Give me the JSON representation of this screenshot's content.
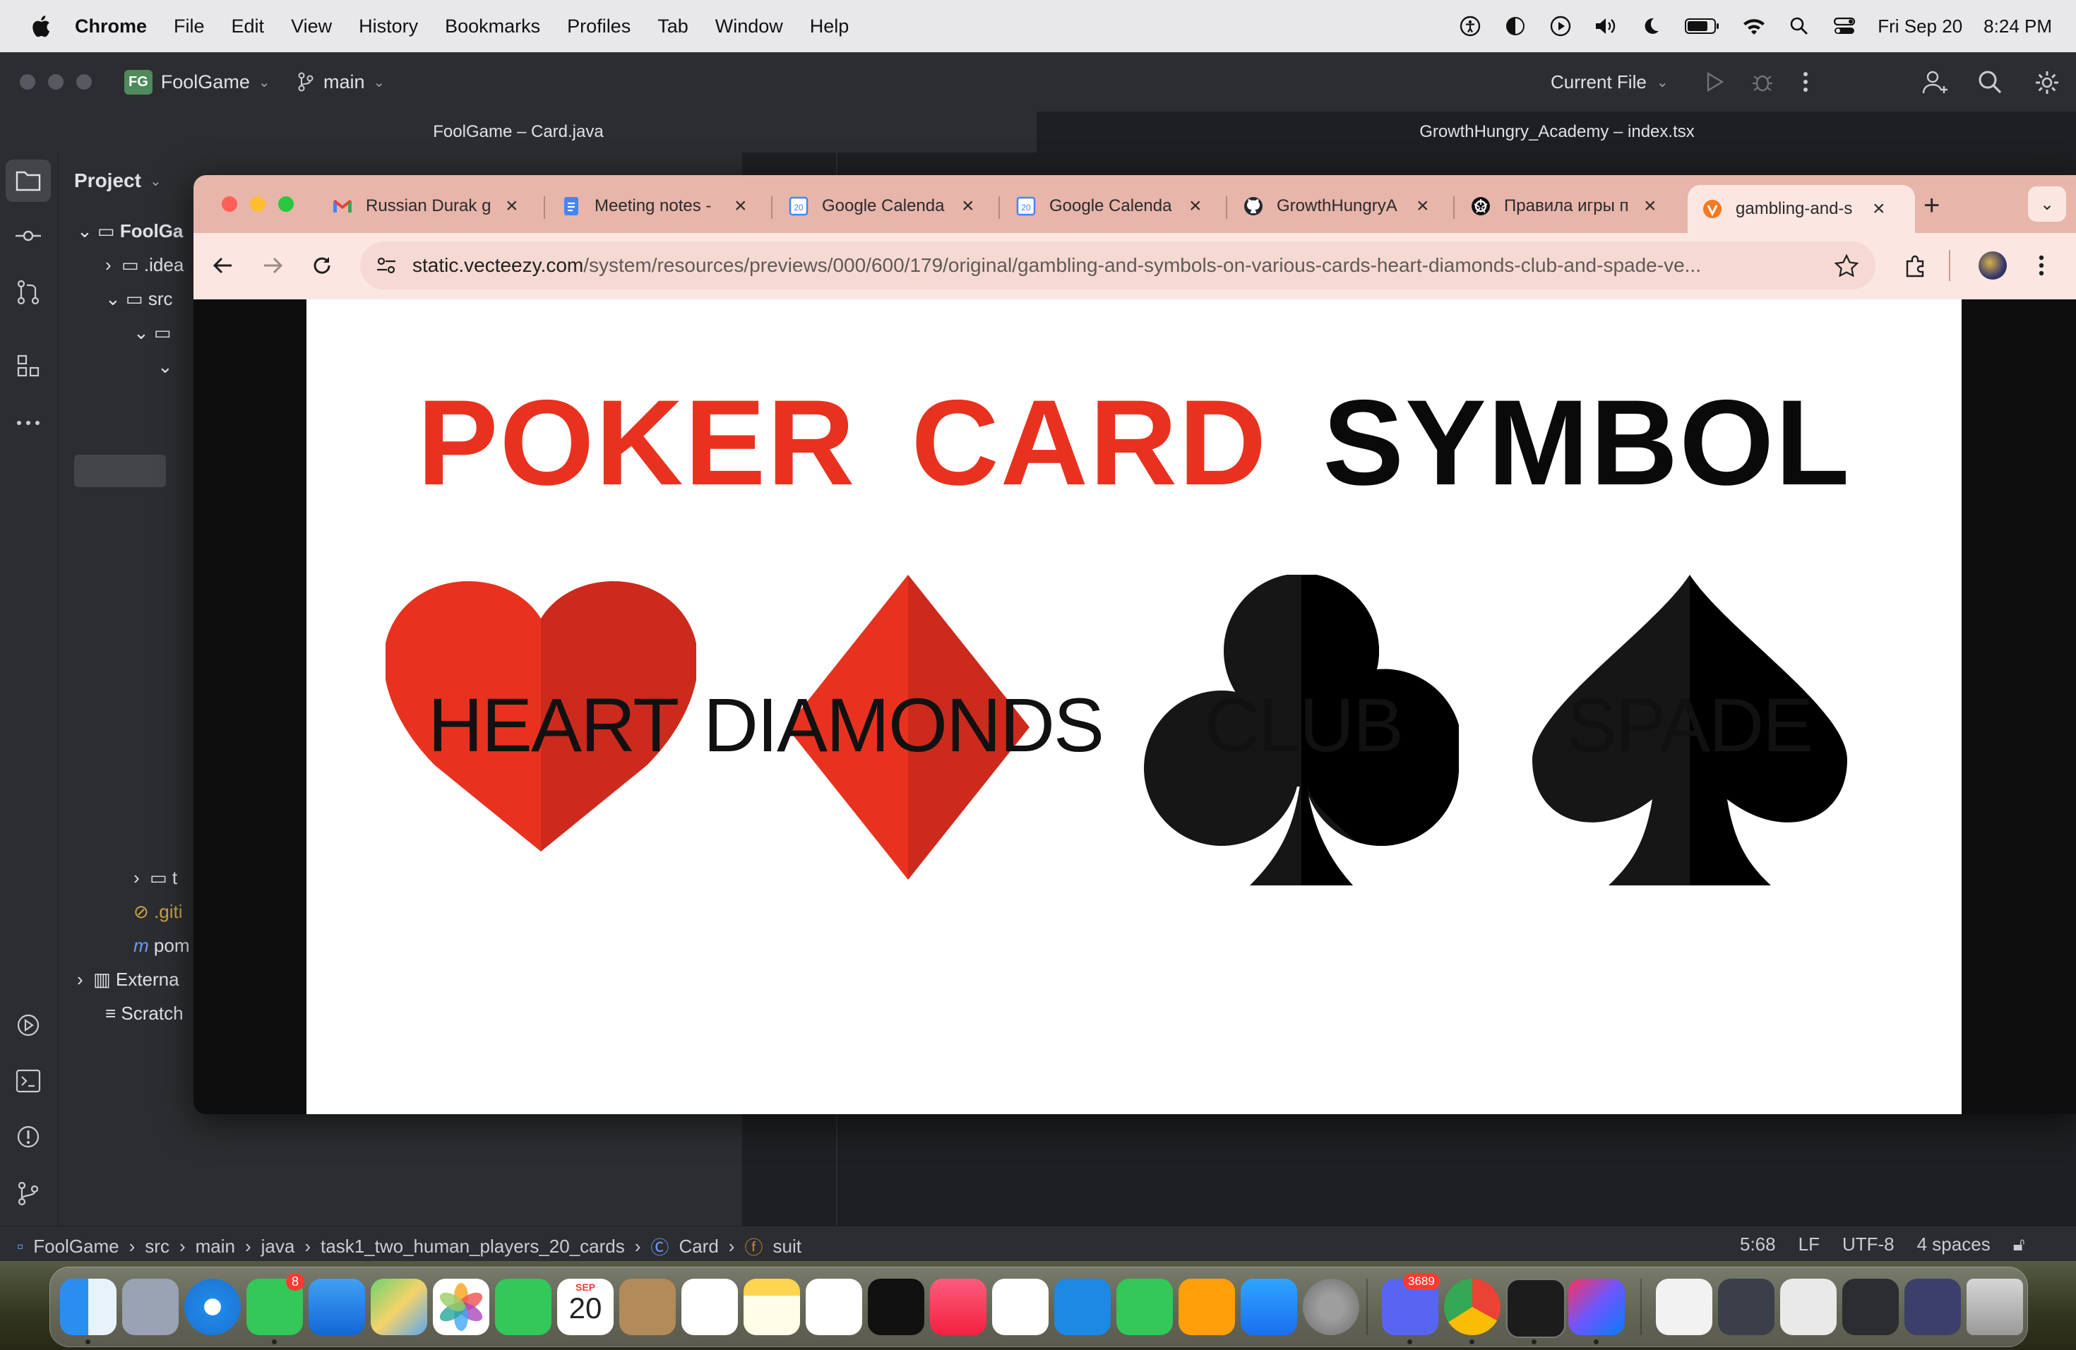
{
  "menubar": {
    "app_name": "Chrome",
    "items": [
      "File",
      "Edit",
      "View",
      "History",
      "Bookmarks",
      "Profiles",
      "Tab",
      "Window",
      "Help"
    ],
    "date": "Fri Sep 20",
    "time": "8:24 PM"
  },
  "ide": {
    "project_badge": "FG",
    "project_name": "FoolGame",
    "branch": "main",
    "run_config": "Current File",
    "window_tabs": [
      "FoolGame – Card.java",
      "GrowthHungry_Academy – index.tsx"
    ],
    "panel_title": "Project",
    "tree": [
      ".idea",
      "src",
      "t",
      ".giti",
      "pom",
      "Externa",
      "Scratch"
    ],
    "tree_root": "FoolGa",
    "breadcrumbs": [
      "FoolGame",
      "src",
      "main",
      "java",
      "task1_two_human_players_20_cards",
      "Card",
      "suit"
    ],
    "status": {
      "position": "5:68",
      "line_ending": "LF",
      "encoding": "UTF-8",
      "indent": "4 spaces"
    }
  },
  "chrome": {
    "tabs": [
      {
        "title": "Russian Durak g",
        "icon": "gmail-icon"
      },
      {
        "title": "Meeting notes -",
        "icon": "docs-icon"
      },
      {
        "title": "Google Calenda",
        "icon": "calendar-icon"
      },
      {
        "title": "Google Calenda",
        "icon": "calendar-icon"
      },
      {
        "title": "GrowthHungryA",
        "icon": "github-icon"
      },
      {
        "title": "Правила игры п",
        "icon": "openai-icon"
      },
      {
        "title": "gambling-and-s",
        "icon": "vecteezy-icon",
        "active": true
      }
    ],
    "url_domain": "static.vecteezy.com",
    "url_path": "/system/resources/previews/000/600/179/original/gambling-and-symbols-on-various-cards-heart-diamonds-club-and-spade-ve..."
  },
  "poster": {
    "title_red_1": "POKER",
    "title_red_2": "CARD",
    "title_black": "SYMBOL",
    "suits": [
      "HEART",
      "DIAMONDS",
      "CLUB",
      "SPADE"
    ],
    "red": "#e8321f",
    "red_dark": "#cc2a1d",
    "black": "#0a0a0a"
  },
  "dock": {
    "messages_badge": "8",
    "calendar_month": "SEP",
    "calendar_day": "20",
    "discord_badge": "3689"
  }
}
